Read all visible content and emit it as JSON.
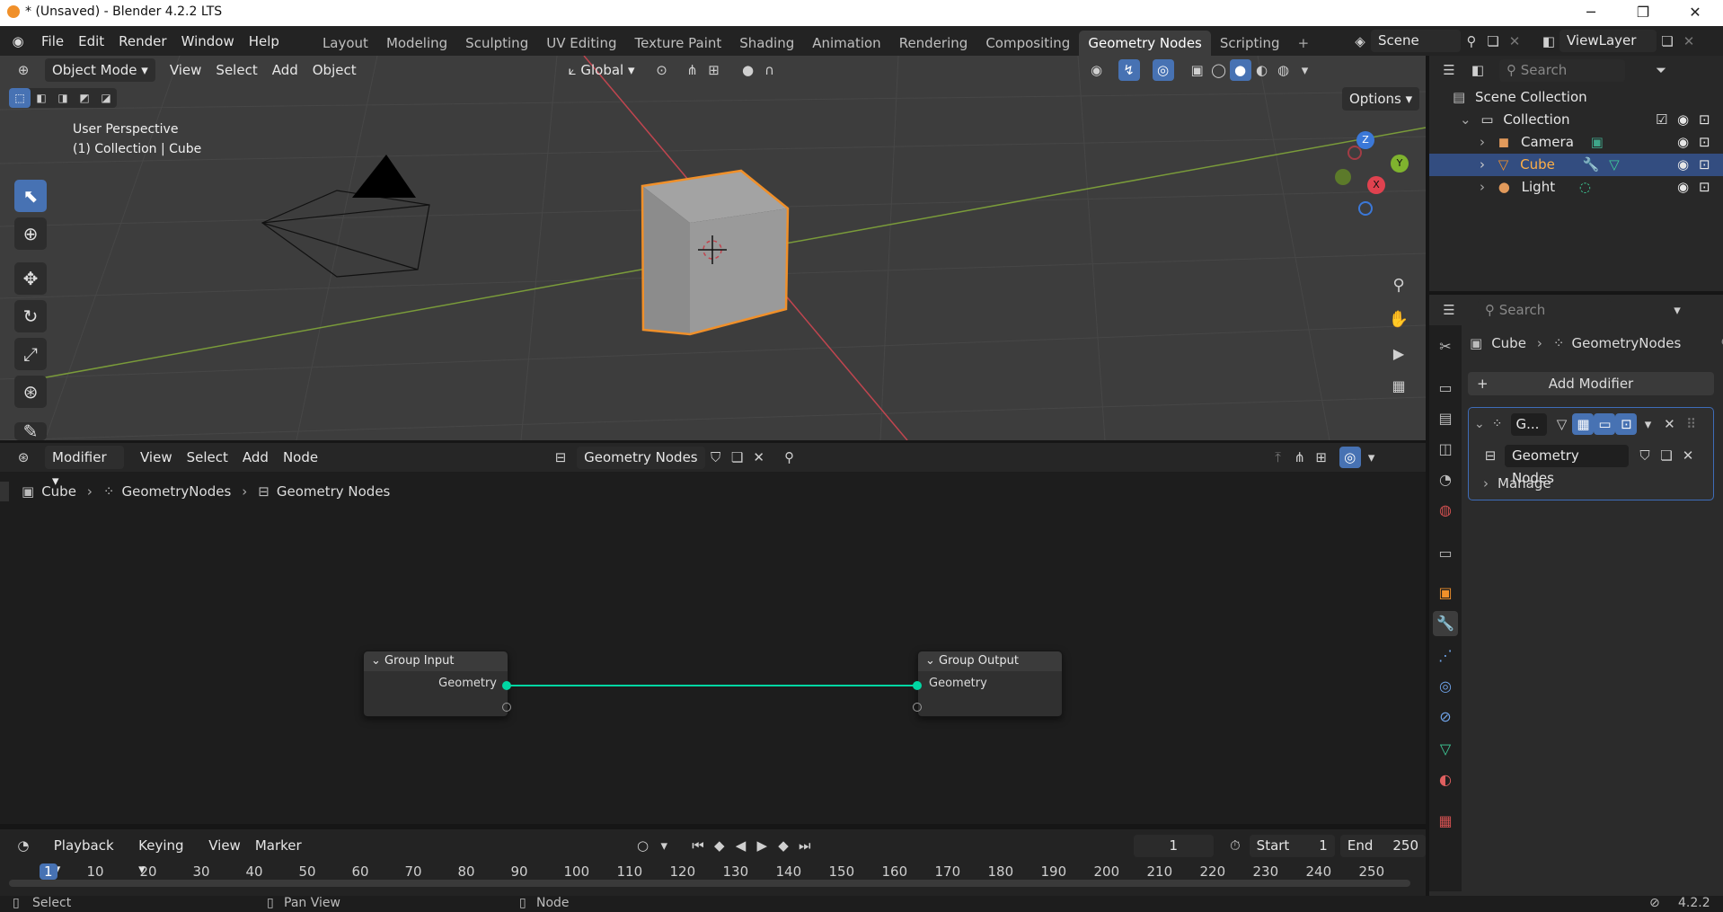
{
  "window": {
    "title": "* (Unsaved) - Blender 4.2.2 LTS",
    "minimize": "─",
    "maximize": "❐",
    "close": "✕"
  },
  "menu": [
    "File",
    "Edit",
    "Render",
    "Window",
    "Help"
  ],
  "workspaces": [
    "Layout",
    "Modeling",
    "Sculpting",
    "UV Editing",
    "Texture Paint",
    "Shading",
    "Animation",
    "Rendering",
    "Compositing",
    "Geometry Nodes",
    "Scripting"
  ],
  "active_workspace": "Geometry Nodes",
  "add_workspace": "+",
  "scene": {
    "name": "Scene",
    "view_layer": "ViewLayer"
  },
  "viewport": {
    "mode": "Object Mode",
    "menus": [
      "View",
      "Select",
      "Add",
      "Object"
    ],
    "transform_orientation": "Global",
    "options": "Options",
    "overlay_line1": "User Perspective",
    "overlay_line2": "(1) Collection | Cube",
    "gizmo": {
      "z": "Z",
      "y": "Y",
      "x": "X"
    }
  },
  "node_editor": {
    "editor_type": "Modifier",
    "menus": [
      "View",
      "Select",
      "Add",
      "Node"
    ],
    "node_group": "Geometry Nodes",
    "breadcrumb": [
      "Cube",
      "GeometryNodes",
      "Geometry Nodes"
    ],
    "nodes": {
      "input": {
        "title": "Group Input",
        "socket": "Geometry"
      },
      "output": {
        "title": "Group Output",
        "socket": "Geometry"
      }
    }
  },
  "timeline": {
    "menus": [
      "Playback",
      "Keying",
      "View",
      "Marker"
    ],
    "current_frame": "1",
    "start_label": "Start",
    "start": "1",
    "end_label": "End",
    "end": "250",
    "ticks": [
      "1",
      "10",
      "20",
      "30",
      "40",
      "50",
      "60",
      "70",
      "80",
      "90",
      "100",
      "110",
      "120",
      "130",
      "140",
      "150",
      "160",
      "170",
      "180",
      "190",
      "200",
      "210",
      "220",
      "230",
      "240",
      "250"
    ]
  },
  "outliner": {
    "search_placeholder": "Search",
    "scene_collection": "Scene Collection",
    "collection": "Collection",
    "items": [
      "Camera",
      "Cube",
      "Light"
    ],
    "selected": "Cube"
  },
  "properties": {
    "search_placeholder": "Search",
    "breadcrumb": [
      "Cube",
      "GeometryNodes"
    ],
    "add_modifier": "Add Modifier",
    "modifier_name": "G...",
    "node_group": "Geometry Nodes",
    "manage": "Manage"
  },
  "status": {
    "select": "Select",
    "pan": "Pan View",
    "node": "Node",
    "version": "4.2.2"
  },
  "colors": {
    "accent": "#4772b3",
    "selection_outline": "#f0902a",
    "geometry_socket": "#00d6a3",
    "x_axis": "#c0454f",
    "y_axis": "#7a9b3a"
  }
}
